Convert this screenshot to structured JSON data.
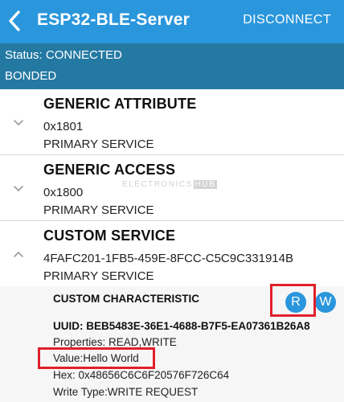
{
  "appbar": {
    "title": "ESP32-BLE-Server",
    "back_icon": "chevron-left-icon",
    "disconnect_label": "DISCONNECT",
    "color": "#2a96dc"
  },
  "status": {
    "line1": "Status: CONNECTED",
    "line2": "BONDED",
    "color": "#2479a3"
  },
  "services": [
    {
      "name": "GENERIC ATTRIBUTE",
      "uuid": "0x1801",
      "type": "PRIMARY SERVICE",
      "expanded": false
    },
    {
      "name": "GENERIC ACCESS",
      "uuid": "0x1800",
      "type": "PRIMARY SERVICE",
      "expanded": false
    },
    {
      "name": "CUSTOM SERVICE",
      "uuid": "4FAFC201-1FB5-459E-8FCC-C5C9C331914B",
      "type": "PRIMARY SERVICE",
      "expanded": true
    }
  ],
  "characteristic": {
    "name": "CUSTOM CHARACTERISTIC",
    "uuid": "UUID: BEB5483E-36E1-4688-B7F5-EA07361B26A8",
    "properties": "Properties: READ,WRITE",
    "value": "Value:Hello World",
    "hex": "Hex: 0x48656C6C6F20576F726C64",
    "write_type": "Write Type:WRITE REQUEST",
    "read_button": "R",
    "write_button": "W"
  },
  "watermark": {
    "text": "ELECTRONICS",
    "hub": "HUB"
  },
  "highlight_color": "#e0202a"
}
